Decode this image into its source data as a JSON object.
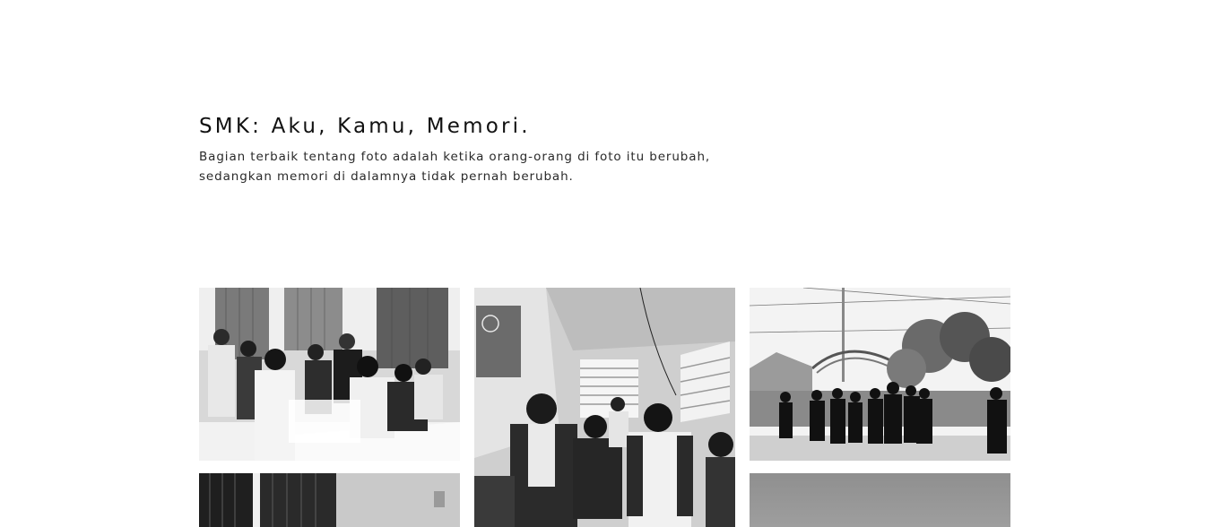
{
  "header": {
    "title": "SMK: Aku, Kamu, Memori.",
    "subtitle_line1": "Bagian terbaik tentang foto adalah ketika orang-orang di foto itu berubah,",
    "subtitle_line2": "sedangkan memori di dalamnya tidak pernah berubah."
  },
  "gallery": {
    "photos": [
      {
        "subject": "students-in-classroom-photo",
        "tone": "grayscale"
      },
      {
        "subject": "students-with-phones-in-hallway-photo",
        "tone": "grayscale"
      },
      {
        "subject": "students-outdoor-group-photo",
        "tone": "grayscale"
      },
      {
        "subject": "classroom-curtains-photo",
        "tone": "grayscale"
      },
      {
        "subject": "overcast-sky-photo",
        "tone": "grayscale"
      }
    ]
  },
  "colors": {
    "background": "#ffffff",
    "text": "#111111"
  }
}
